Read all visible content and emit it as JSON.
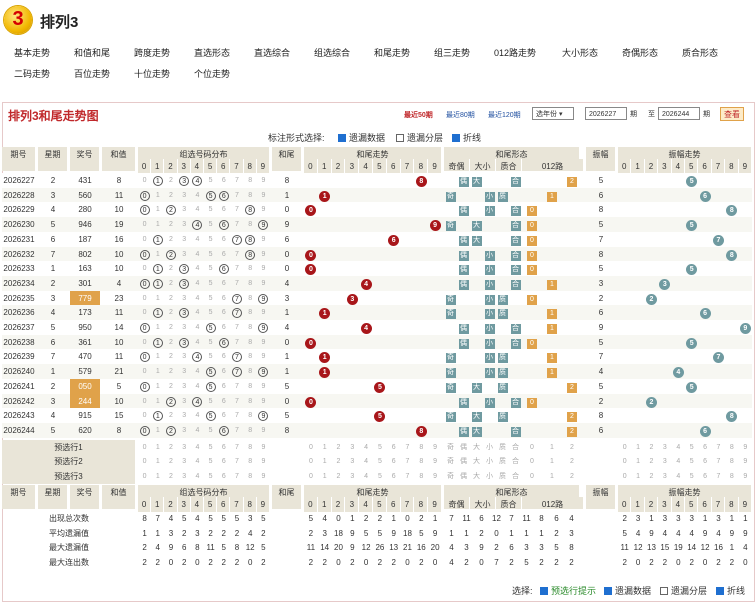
{
  "app": {
    "title": "排列3",
    "logo_text": "3"
  },
  "nav": [
    "基本走势",
    "和值和尾",
    "跨度走势",
    "直选形态",
    "直选综合",
    "组选综合",
    "和尾走势",
    "组三走势",
    "012路走势",
    "大小形态",
    "奇偶形态",
    "质合形态",
    "二码走势",
    "百位走势",
    "十位走势",
    "个位走势"
  ],
  "panel": {
    "title": "排列3和尾走势图",
    "recent": [
      "最近50期",
      "最近80期",
      "最近120期"
    ],
    "select_label": "选年份",
    "from": "2026227",
    "period1": "期",
    "to_label": "至",
    "to": "2026244",
    "period2": "期",
    "query": "查看"
  },
  "options": {
    "label": "标注形式选择:",
    "items": [
      {
        "label": "遗漏数据",
        "on": true
      },
      {
        "label": "遗漏分层",
        "on": false
      },
      {
        "label": "折线",
        "on": true
      }
    ]
  },
  "header": {
    "issue": "期号",
    "week": "星期",
    "prize": "奖号",
    "sum": "和值",
    "zxdist": "组选号码分布",
    "tail": "和尾",
    "tailtrend": "和尾走势",
    "tailshape": "和尾形态",
    "oe": "奇偶",
    "bs": "大小",
    "pc": "质合",
    "r012": "012路",
    "amp": "振幅",
    "amptrend": "振幅走势",
    "oddeven": [
      "奇",
      "偶"
    ],
    "bigsmall": [
      "大",
      "小"
    ],
    "primecomp": [
      "质",
      "合"
    ],
    "road": [
      "0",
      "1",
      "2"
    ]
  },
  "rows": [
    {
      "issue": "2026227",
      "week": "2",
      "prize": "431",
      "sum": "8",
      "tail": "8",
      "amp": "5"
    },
    {
      "issue": "2026228",
      "week": "3",
      "prize": "560",
      "sum": "11",
      "tail": "1",
      "amp": "6"
    },
    {
      "issue": "2026229",
      "week": "4",
      "prize": "280",
      "sum": "10",
      "tail": "0",
      "amp": "8"
    },
    {
      "issue": "2026230",
      "week": "5",
      "prize": "946",
      "sum": "19",
      "tail": "9",
      "amp": "5"
    },
    {
      "issue": "2026231",
      "week": "6",
      "prize": "187",
      "sum": "16",
      "tail": "6",
      "amp": "7"
    },
    {
      "issue": "2026232",
      "week": "7",
      "prize": "802",
      "sum": "10",
      "tail": "0",
      "amp": "8"
    },
    {
      "issue": "2026233",
      "week": "1",
      "prize": "163",
      "sum": "10",
      "tail": "0",
      "amp": "5"
    },
    {
      "issue": "2026234",
      "week": "2",
      "prize": "301",
      "sum": "4",
      "tail": "4",
      "amp": "3"
    },
    {
      "issue": "2026235",
      "week": "3",
      "prize": "779",
      "sum": "23",
      "tail": "3",
      "amp": "2"
    },
    {
      "issue": "2026236",
      "week": "4",
      "prize": "173",
      "sum": "11",
      "tail": "1",
      "amp": "6"
    },
    {
      "issue": "2026237",
      "week": "5",
      "prize": "950",
      "sum": "14",
      "tail": "4",
      "amp": "9"
    },
    {
      "issue": "2026238",
      "week": "6",
      "prize": "361",
      "sum": "10",
      "tail": "0",
      "amp": "5"
    },
    {
      "issue": "2026239",
      "week": "7",
      "prize": "470",
      "sum": "11",
      "tail": "1",
      "amp": "7"
    },
    {
      "issue": "2026240",
      "week": "1",
      "prize": "579",
      "sum": "21",
      "tail": "1",
      "amp": "4"
    },
    {
      "issue": "2026241",
      "week": "2",
      "prize": "050",
      "sum": "5",
      "tail": "5",
      "amp": "5"
    },
    {
      "issue": "2026242",
      "week": "3",
      "prize": "244",
      "sum": "10",
      "tail": "0",
      "amp": "2"
    },
    {
      "issue": "2026243",
      "week": "4",
      "prize": "915",
      "sum": "15",
      "tail": "5",
      "amp": "8"
    },
    {
      "issue": "2026244",
      "week": "5",
      "prize": "620",
      "sum": "8",
      "tail": "8",
      "amp": "6"
    }
  ],
  "preselect": [
    "预选行1",
    "预选行2",
    "预选行3"
  ],
  "stats": [
    {
      "label": "出现总次数",
      "dist": [
        "8",
        "7",
        "4",
        "5",
        "4",
        "5",
        "5",
        "5",
        "3",
        "5"
      ],
      "tail": [
        "5",
        "4",
        "0",
        "1",
        "2",
        "2",
        "1",
        "0",
        "2",
        "1"
      ],
      "shape": [
        "7",
        "11",
        "6",
        "12",
        "7",
        "11",
        "8",
        "6",
        "4"
      ],
      "amp": [
        "2",
        "3",
        "1",
        "3",
        "3",
        "3",
        "1",
        "3",
        "1",
        "1"
      ]
    },
    {
      "label": "平均遗漏值",
      "dist": [
        "1",
        "1",
        "3",
        "2",
        "3",
        "2",
        "2",
        "2",
        "4",
        "2"
      ],
      "tail": [
        "2",
        "3",
        "18",
        "9",
        "5",
        "5",
        "9",
        "18",
        "5",
        "9"
      ],
      "shape": [
        "1",
        "1",
        "2",
        "0",
        "1",
        "1",
        "1",
        "2",
        "3"
      ],
      "amp": [
        "5",
        "4",
        "9",
        "4",
        "4",
        "4",
        "9",
        "4",
        "9",
        "9"
      ]
    },
    {
      "label": "最大遗漏值",
      "dist": [
        "2",
        "4",
        "9",
        "6",
        "8",
        "11",
        "5",
        "8",
        "12",
        "5"
      ],
      "tail": [
        "11",
        "14",
        "20",
        "9",
        "12",
        "26",
        "13",
        "21",
        "16",
        "20"
      ],
      "shape": [
        "4",
        "3",
        "9",
        "2",
        "6",
        "3",
        "3",
        "5",
        "8"
      ],
      "amp": [
        "11",
        "12",
        "13",
        "15",
        "19",
        "14",
        "12",
        "16",
        "1",
        "4"
      ]
    },
    {
      "label": "最大连出数",
      "dist": [
        "2",
        "2",
        "0",
        "2",
        "0",
        "2",
        "2",
        "2",
        "0",
        "2"
      ],
      "tail": [
        "2",
        "2",
        "0",
        "2",
        "0",
        "2",
        "2",
        "0",
        "2",
        "0"
      ],
      "shape": [
        "4",
        "2",
        "0",
        "7",
        "2",
        "5",
        "2",
        "2",
        "2"
      ],
      "amp": [
        "2",
        "0",
        "2",
        "2",
        "0",
        "2",
        "0",
        "2",
        "2",
        "0"
      ]
    }
  ],
  "footer": {
    "label": "选择:",
    "items": [
      {
        "label": "预选行提示",
        "on": true
      },
      {
        "label": "遗漏数据",
        "on": true
      },
      {
        "label": "遗漏分层",
        "on": false
      },
      {
        "label": "折线",
        "on": true
      }
    ]
  },
  "colors": {
    "accent": "#c0282b",
    "ball_tail": "#a8161a",
    "ball_amp": "#6f9aa0",
    "tag": "#e0a24a",
    "header": "#e9e5d8"
  }
}
